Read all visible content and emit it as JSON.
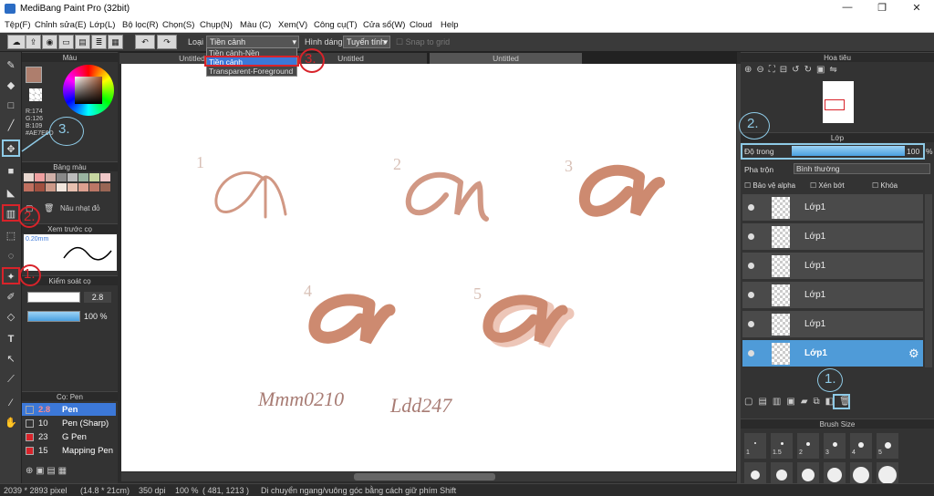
{
  "window": {
    "title": "MediBang Paint Pro (32bit)",
    "min": "—",
    "max": "❐",
    "close": "✕"
  },
  "menu": [
    "Tệp(F)",
    "Chỉnh sửa(E)",
    "Lớp(L)",
    "Bộ lọc(R)",
    "Chọn(S)",
    "Chụp(N)",
    "Màu (C)",
    "Xem(V)",
    "Công cụ(T)",
    "Cửa sổ(W)",
    "Cloud",
    "Help"
  ],
  "toolbar": {
    "type_label": "Loại",
    "type_value": "Tiền cảnh",
    "shape_label": "Hình dáng",
    "shape_value": "Tuyến tính",
    "snap_label": "Snap to grid",
    "dropdown_options": [
      "Tiền cảnh-Nền",
      "Tiền cảnh",
      "Transparent-Foreground"
    ]
  },
  "tabs": [
    "Untitled",
    "Untitled",
    "Untitled"
  ],
  "color_panel": {
    "title": "Màu",
    "r": "R:174",
    "g": "G:126",
    "b": "B:109",
    "hex": "#AE7E6D",
    "fg": "#ae7e6d"
  },
  "palette": {
    "title": "Bảng màu",
    "swatch_label": "Nâu nhạt đỏ",
    "colors": [
      "#e8d8d0",
      "#f0a0a0",
      "#d0b0a8",
      "#888888",
      "#bbbbbb",
      "#99b3a0",
      "#c6d6a0",
      "#f0c8c8",
      "#c07060",
      "#a05040",
      "#cc9988",
      "#f2e6dd",
      "#e8c0b0",
      "#dda090",
      "#bb7766",
      "#996655"
    ]
  },
  "brush_preview": {
    "title": "Xem trước cọ",
    "size_label": "0.20mm"
  },
  "brush_control": {
    "title": "Kiểm soát cọ",
    "size": "2.8",
    "opacity": "100 %"
  },
  "brush_list": {
    "title": "Cọ: Pen",
    "items": [
      {
        "size": "2.8",
        "name": "Pen",
        "color": "#3c78d8"
      },
      {
        "size": "10",
        "name": "Pen (Sharp)",
        "color": "#333333"
      },
      {
        "size": "23",
        "name": "G Pen",
        "color": "#d8232a"
      },
      {
        "size": "15",
        "name": "Mapping Pen",
        "color": "#d8232a"
      }
    ]
  },
  "canvas": {
    "labels": [
      "1",
      "2",
      "3",
      "4",
      "5"
    ],
    "sign1": "Mmm0210",
    "sign2": "Ldd247",
    "ink": "#d19884"
  },
  "navigator": {
    "title": "Hoa tiêu"
  },
  "layer_panel": {
    "title": "Lớp",
    "opacity_label": "Độ trong",
    "opacity_value": "100",
    "opacity_unit": "%",
    "blend_label": "Pha trộn",
    "blend_value": "Bình thường",
    "protect_alpha": "Bảo vệ alpha",
    "clipping": "Xén bớt",
    "lock": "Khóa",
    "layers": [
      "Lớp1",
      "Lớp1",
      "Lớp1",
      "Lớp1",
      "Lớp1",
      "Lớp1"
    ]
  },
  "brush_size": {
    "title": "Brush Size",
    "sizes": [
      "1",
      "1.5",
      "2",
      "3",
      "4",
      "5"
    ]
  },
  "status": {
    "pixel": "2039 * 2893 pixel",
    "cm": "(14.8 * 21cm)",
    "dpi": "350 dpi",
    "zoom": "100 %",
    "coords": "( 481, 1213 )",
    "hint": "Di chuyển ngang/vuông góc bằng cách giữ phím Shift"
  },
  "annotations": {
    "one": "1.",
    "two": "2.",
    "three": "3."
  }
}
